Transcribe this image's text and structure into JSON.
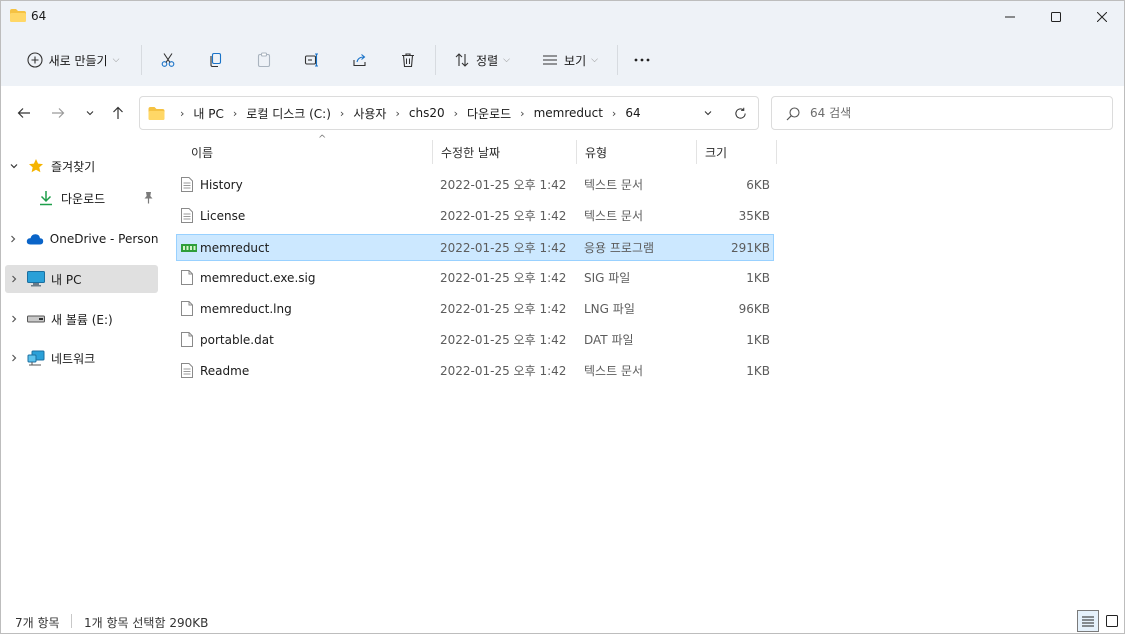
{
  "window": {
    "title": "64"
  },
  "toolbar": {
    "new_label": "새로 만들기",
    "sort_label": "정렬",
    "view_label": "보기"
  },
  "address": {
    "crumbs": [
      "내 PC",
      "로컬 디스크 (C:)",
      "사용자",
      "chs20",
      "다운로드",
      "memreduct",
      "64"
    ]
  },
  "search": {
    "placeholder": "64 검색"
  },
  "sidebar": {
    "items": [
      {
        "label": "즐겨찾기"
      },
      {
        "label": "다운로드"
      },
      {
        "label": "OneDrive - Persona"
      },
      {
        "label": "내 PC"
      },
      {
        "label": "새 볼륨 (E:)"
      },
      {
        "label": "네트워크"
      }
    ]
  },
  "columns": {
    "name": "이름",
    "date": "수정한 날짜",
    "type": "유형",
    "size": "크기"
  },
  "files": [
    {
      "name": "History",
      "date": "2022-01-25 오후 1:42",
      "type": "텍스트 문서",
      "size": "6KB",
      "icon": "text-file-icon"
    },
    {
      "name": "License",
      "date": "2022-01-25 오후 1:42",
      "type": "텍스트 문서",
      "size": "35KB",
      "icon": "text-file-icon"
    },
    {
      "name": "memreduct",
      "date": "2022-01-25 오후 1:42",
      "type": "응용 프로그램",
      "size": "291KB",
      "icon": "application-icon",
      "selected": true
    },
    {
      "name": "memreduct.exe.sig",
      "date": "2022-01-25 오후 1:42",
      "type": "SIG 파일",
      "size": "1KB",
      "icon": "blank-file-icon"
    },
    {
      "name": "memreduct.lng",
      "date": "2022-01-25 오후 1:42",
      "type": "LNG 파일",
      "size": "96KB",
      "icon": "blank-file-icon"
    },
    {
      "name": "portable.dat",
      "date": "2022-01-25 오후 1:42",
      "type": "DAT 파일",
      "size": "1KB",
      "icon": "blank-file-icon"
    },
    {
      "name": "Readme",
      "date": "2022-01-25 오후 1:42",
      "type": "텍스트 문서",
      "size": "1KB",
      "icon": "text-file-icon"
    }
  ],
  "status": {
    "count": "7개 항목",
    "selection": "1개 항목 선택함 290KB"
  },
  "colors": {
    "accent": "#0067c0",
    "selection_bg": "#cce8ff",
    "selection_border": "#99d1ff",
    "folder": "#f5c242"
  }
}
